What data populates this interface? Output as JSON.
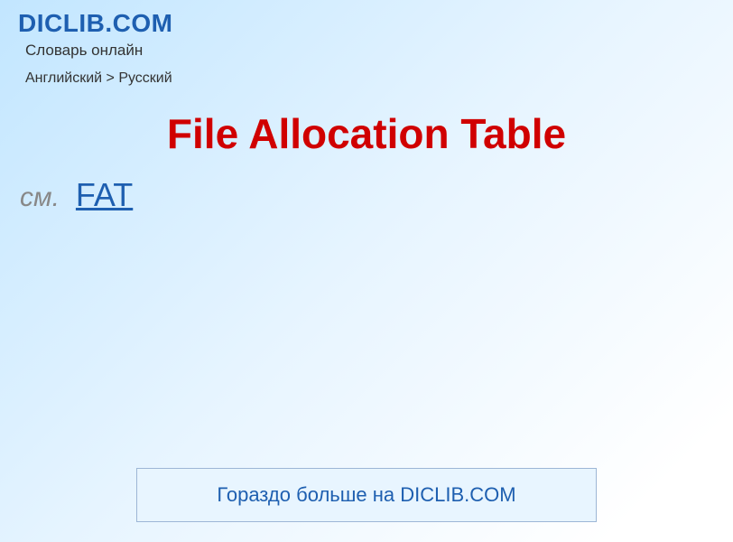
{
  "header": {
    "site_title": "DICLIB.COM",
    "subtitle": "Словарь онлайн"
  },
  "breadcrumb": {
    "text": "Английский > Русский"
  },
  "entry": {
    "title": "File Allocation Table",
    "see_label": "см.",
    "see_link": "FAT"
  },
  "footer": {
    "banner_text": "Гораздо больше на DICLIB.COM"
  }
}
